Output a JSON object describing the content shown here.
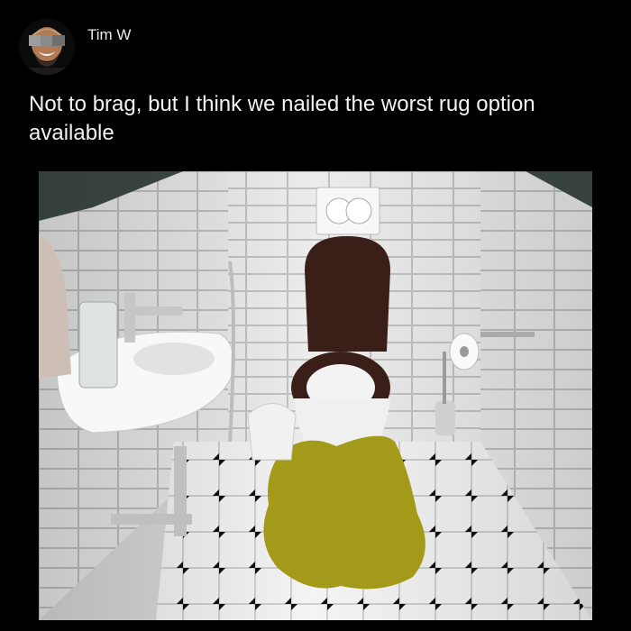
{
  "post": {
    "author": {
      "name": "Tim W",
      "avatar_icon": "avatar-face-icon"
    },
    "text": "Not to brag, but I think we nailed the worst rug option available"
  },
  "colors": {
    "background": "#000000",
    "text": "#e7e9ea",
    "rug": "#a39a1a",
    "seat": "#3a1f18"
  }
}
